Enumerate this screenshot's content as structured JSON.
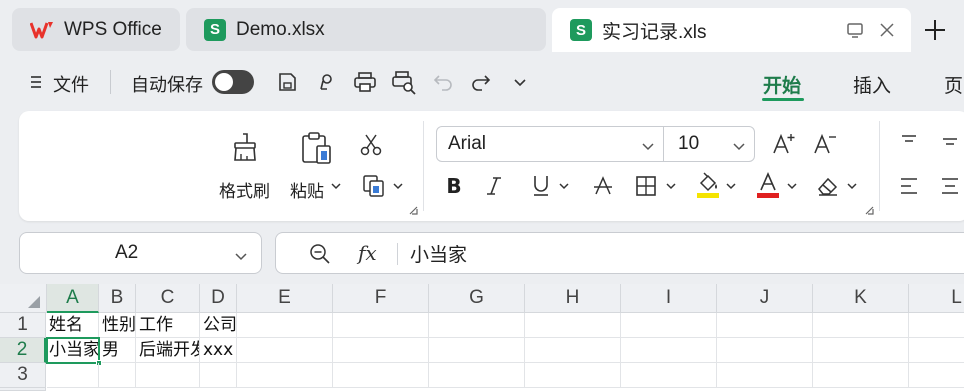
{
  "tabs": [
    {
      "label": "WPS Office",
      "icon": "wps-logo-icon"
    },
    {
      "label": "Demo.xlsx",
      "icon": "spreadsheet-s-icon"
    },
    {
      "label": "实习记录.xls",
      "icon": "spreadsheet-s-icon",
      "active": true
    }
  ],
  "badge_letter": "S",
  "toolbar": {
    "file_label": "文件",
    "autosave_label": "自动保存"
  },
  "ribbon_tabs": [
    {
      "label": "开始",
      "active": true
    },
    {
      "label": "插入"
    },
    {
      "label": "页"
    }
  ],
  "ribbon": {
    "format_painter_label": "格式刷",
    "paste_label": "粘贴",
    "font_name": "Arial",
    "font_size": "10"
  },
  "formula_bar": {
    "cell_ref": "A2",
    "fx_label": "fx",
    "content": "小当家"
  },
  "columns": [
    "A",
    "B",
    "C",
    "D",
    "E",
    "F",
    "G",
    "H",
    "I",
    "J",
    "K",
    "L"
  ],
  "rows": [
    "1",
    "2",
    "3"
  ],
  "cells": {
    "r1": [
      "姓名",
      "性别",
      "工作",
      "公司"
    ],
    "r2": [
      "小当家",
      "男",
      "后端开发",
      "xxx"
    ]
  },
  "colors": {
    "accent": "#1e9a5d",
    "highlight": "#f5e400",
    "font_color": "#e02020"
  }
}
